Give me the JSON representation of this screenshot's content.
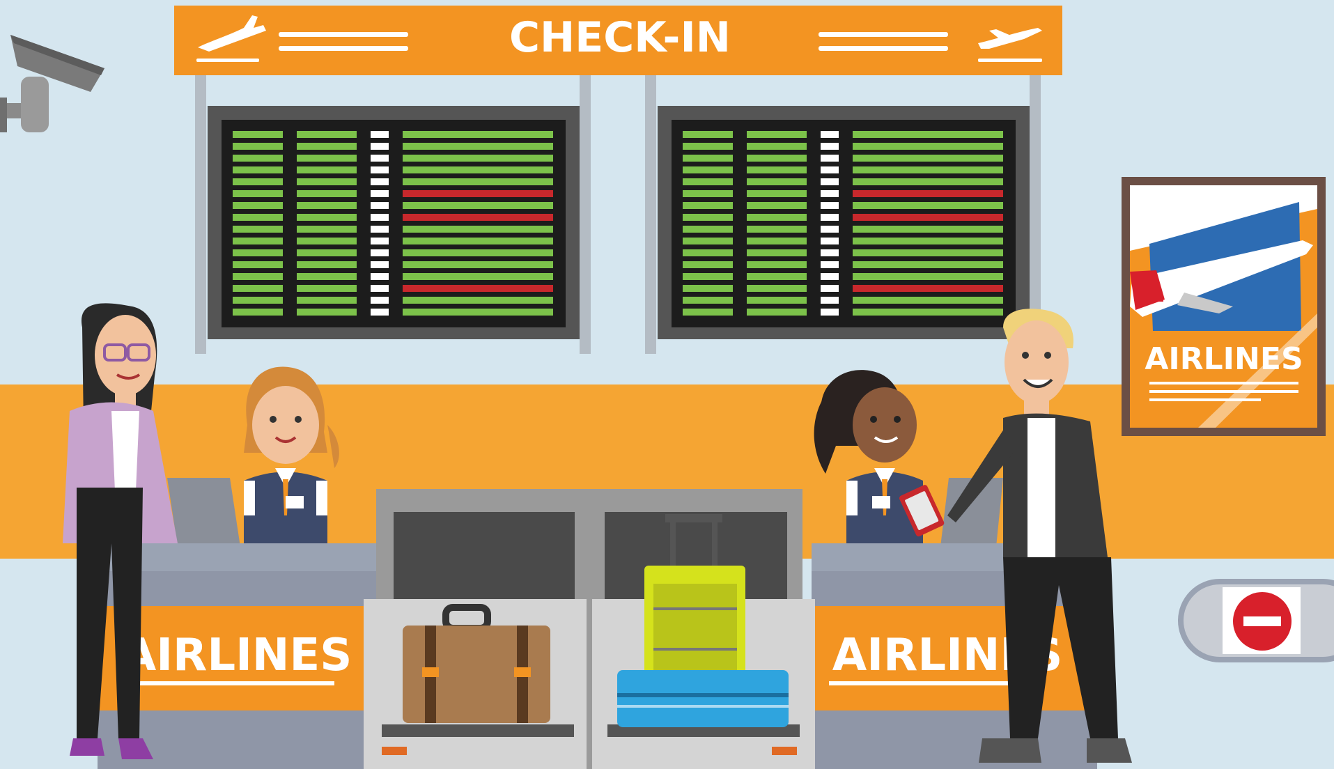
{
  "sign": {
    "title": "CHECK-IN"
  },
  "counters": {
    "left_brand": "AIRLINES",
    "right_brand": "AIRLINES"
  },
  "poster": {
    "brand": "AIRLINES"
  },
  "colors": {
    "wall": "#d5e6ef",
    "stripe": "#f5a533",
    "orange": "#f39422",
    "board_frame": "#555555",
    "board_screen": "#1c1c1c",
    "row_green": "#7cc24a",
    "row_red": "#c8282c",
    "counter_top": "#9aa3b3",
    "counter_body": "#8f96a7",
    "conveyor": "#9a9a9a",
    "no_entry": "#d8202b"
  },
  "icons": {
    "left_sign_icon": "plane-landing-icon",
    "right_sign_icon": "plane-departure-icon",
    "camera": "security-camera-icon",
    "no_entry": "no-entry-icon"
  }
}
